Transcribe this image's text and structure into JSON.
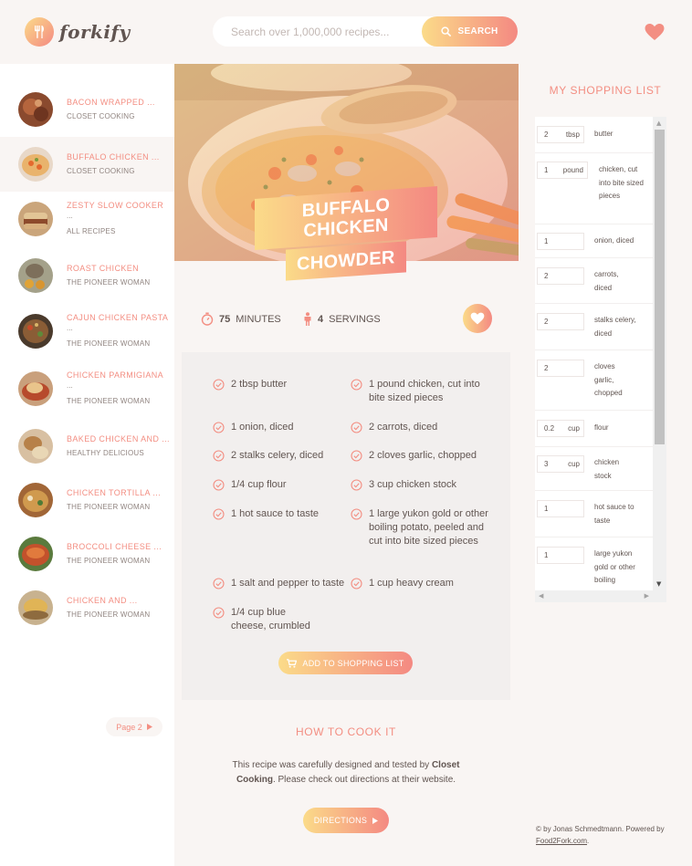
{
  "header": {
    "logo_text": "forkify",
    "search_placeholder": "Search over 1,000,000 recipes...",
    "search_button": "SEARCH"
  },
  "results": [
    {
      "title": "BACON WRAPPED ...",
      "publisher": "CLOSET COOKING",
      "extra": ""
    },
    {
      "title": "BUFFALO CHICKEN ...",
      "publisher": "CLOSET COOKING",
      "extra": ""
    },
    {
      "title": "ZESTY SLOW COOKER",
      "publisher": "ALL RECIPES",
      "extra": "..."
    },
    {
      "title": "ROAST CHICKEN",
      "publisher": "THE PIONEER WOMAN",
      "extra": ""
    },
    {
      "title": "CAJUN CHICKEN PASTA",
      "publisher": "THE PIONEER WOMAN",
      "extra": "..."
    },
    {
      "title": "CHICKEN PARMIGIANA",
      "publisher": "THE PIONEER WOMAN",
      "extra": "..."
    },
    {
      "title": "BAKED CHICKEN AND ...",
      "publisher": "HEALTHY DELICIOUS",
      "extra": ""
    },
    {
      "title": "CHICKEN TORTILLA ...",
      "publisher": "THE PIONEER WOMAN",
      "extra": ""
    },
    {
      "title": "BROCCOLI CHEESE ...",
      "publisher": "THE PIONEER WOMAN",
      "extra": ""
    },
    {
      "title": "CHICKEN AND ...",
      "publisher": "THE PIONEER WOMAN",
      "extra": ""
    }
  ],
  "pagination": {
    "next_label": "Page 2"
  },
  "recipe": {
    "title_line1": "BUFFALO CHICKEN",
    "title_line2": "CHOWDER",
    "minutes": "75",
    "minutes_label": "MINUTES",
    "servings": "4",
    "servings_label": "SERVINGS",
    "ingredients": [
      "2 tbsp butter",
      "1 pound chicken, cut into bite sized pieces",
      "1 onion, diced",
      "2 carrots, diced",
      "2 stalks celery, diced",
      "2 cloves garlic, chopped",
      "1/4 cup flour",
      "3 cup chicken stock",
      "1 hot sauce to taste",
      "1 large yukon gold or other boiling potato, peeled and cut into bite sized pieces",
      "1 salt and pepper to taste",
      "1 cup heavy cream",
      "1/4 cup blue cheese, crumbled"
    ],
    "add_button": "ADD TO SHOPPING LIST",
    "directions_heading": "HOW TO COOK IT",
    "directions_text_pre": "This recipe was carefully designed and tested by ",
    "directions_publisher": "Closet Cooking",
    "directions_text_post": ". Please check out directions at their website.",
    "directions_button": "DIRECTIONS"
  },
  "shopping": {
    "heading": "MY SHOPPING LIST",
    "items": [
      {
        "count": "2",
        "unit": "tbsp",
        "desc": "butter"
      },
      {
        "count": "1",
        "unit": "pound",
        "desc": "chicken, cut into bite sized pieces"
      },
      {
        "count": "1",
        "unit": "",
        "desc": "onion, diced"
      },
      {
        "count": "2",
        "unit": "",
        "desc": "carrots, diced"
      },
      {
        "count": "2",
        "unit": "",
        "desc": "stalks celery, diced"
      },
      {
        "count": "2",
        "unit": "",
        "desc": "cloves garlic, chopped"
      },
      {
        "count": "0.2",
        "unit": "cup",
        "desc": "flour"
      },
      {
        "count": "3",
        "unit": "cup",
        "desc": "chicken stock"
      },
      {
        "count": "1",
        "unit": "",
        "desc": "hot sauce to taste"
      },
      {
        "count": "1",
        "unit": "",
        "desc": "large yukon gold or other boiling"
      }
    ]
  },
  "footer": {
    "copyright_pre": "© by Jonas Schmedtmann. Powered by ",
    "copyright_link": "Food2Fork.com",
    "copyright_post": "."
  },
  "colors": {
    "accent_start": "#fbdb89",
    "accent_end": "#f48982",
    "text": "#615551",
    "accent_text": "#f38e82"
  }
}
